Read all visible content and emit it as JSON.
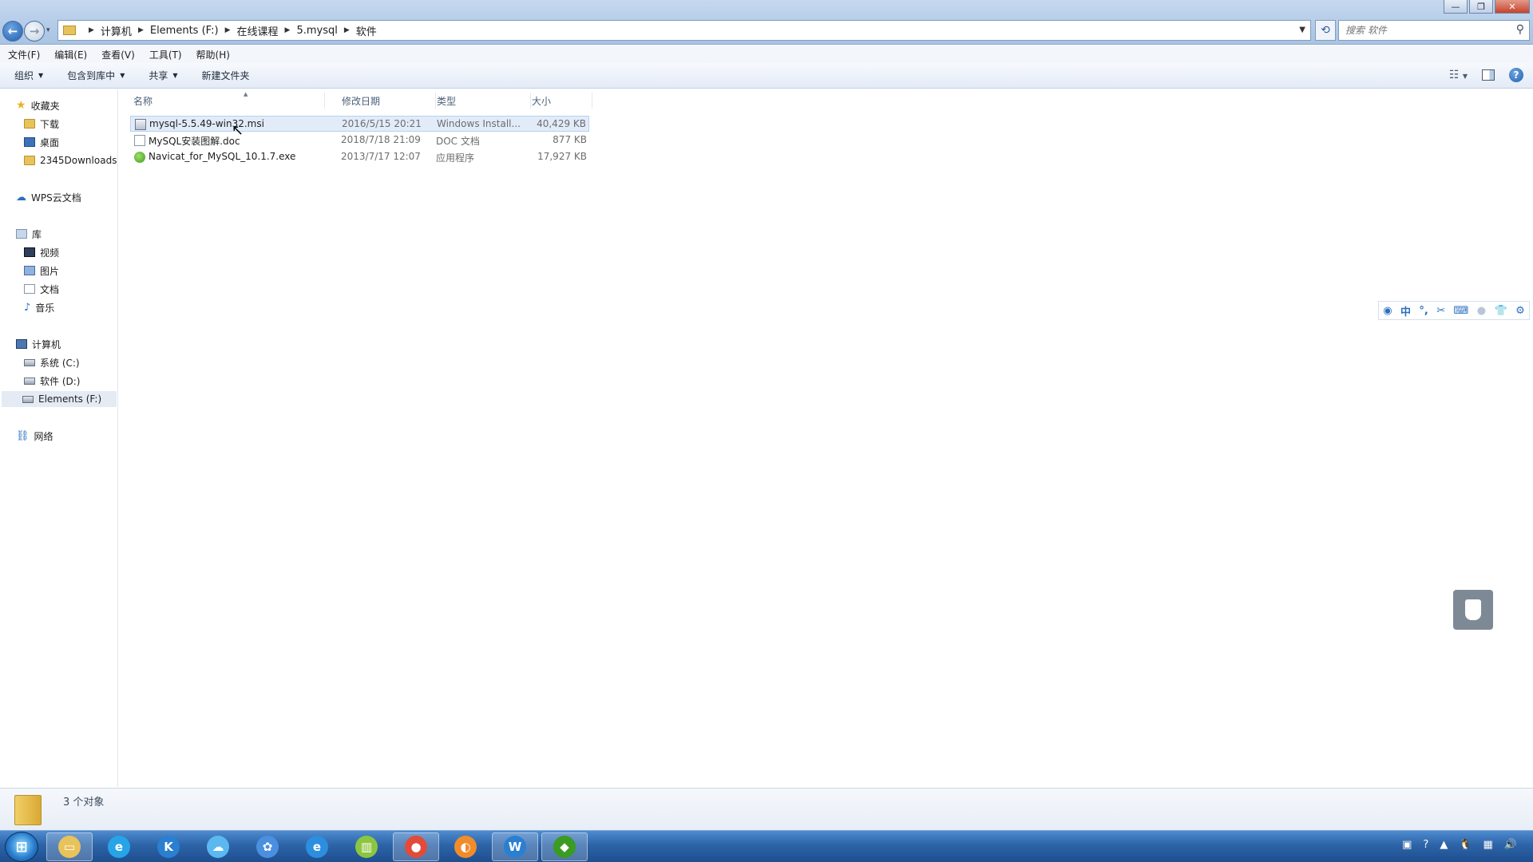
{
  "window": {
    "nav": {
      "back": "←",
      "forward": "→",
      "dropdown": "▾"
    },
    "breadcrumb": [
      "计算机",
      "Elements (F:)",
      "在线课程",
      "5.mysql",
      "软件"
    ],
    "search_placeholder": "搜索 软件",
    "controls": {
      "minimize": "—",
      "maximize": "❐",
      "close": "✕"
    }
  },
  "menubar": [
    "文件(F)",
    "编辑(E)",
    "查看(V)",
    "工具(T)",
    "帮助(H)"
  ],
  "commands": [
    {
      "label": "组织",
      "has_menu": true
    },
    {
      "label": "包含到库中",
      "has_menu": true
    },
    {
      "label": "共享",
      "has_menu": true
    },
    {
      "label": "新建文件夹",
      "has_menu": false
    }
  ],
  "command_right": {
    "help": "?"
  },
  "sidebar": {
    "favorites": {
      "label": "收藏夹",
      "items": [
        "下载",
        "桌面",
        "2345Downloads"
      ]
    },
    "wps": {
      "label": "WPS云文档"
    },
    "libraries": {
      "label": "库",
      "items": [
        "视频",
        "图片",
        "文档",
        "音乐"
      ]
    },
    "computer": {
      "label": "计算机",
      "items": [
        "系统 (C:)",
        "软件 (D:)",
        "Elements (F:)"
      ],
      "selected": "Elements (F:)"
    },
    "network": {
      "label": "网络"
    }
  },
  "columns": {
    "name": "名称",
    "date": "修改日期",
    "type": "类型",
    "size": "大小"
  },
  "files": [
    {
      "name": "mysql-5.5.49-win32.msi",
      "date": "2016/5/15 20:21",
      "type": "Windows Install...",
      "size": "40,429 KB",
      "icon": "msi-installer-icon",
      "selected": true
    },
    {
      "name": "MySQL安装图解.doc",
      "date": "2018/7/18 21:09",
      "type": "DOC 文档",
      "size": "877 KB",
      "icon": "doc-icon",
      "selected": false
    },
    {
      "name": "Navicat_for_MySQL_10.1.7.exe",
      "date": "2013/7/17 12:07",
      "type": "应用程序",
      "size": "17,927 KB",
      "icon": "navicat-app-icon",
      "selected": false
    }
  ],
  "ime_toolbar": {
    "mode": "中",
    "items": [
      "user-icon",
      "chinese-mode-icon",
      "punctuation-icon",
      "scissors-icon",
      "keyboard-icon",
      "person-icon",
      "skin-icon",
      "settings-icon"
    ]
  },
  "status": {
    "count_text": "3 个对象"
  },
  "taskbar": {
    "start_label": "⊞",
    "apps": [
      {
        "name": "explorer",
        "glyph": "▭",
        "color": "#e8c25a",
        "active": true
      },
      {
        "name": "browser-e",
        "glyph": "e",
        "color": "#27a4e8",
        "active": false
      },
      {
        "name": "k-app",
        "glyph": "K",
        "color": "#2a7fd0",
        "active": false
      },
      {
        "name": "cloud-app",
        "glyph": "☁",
        "color": "#5bb8f0",
        "active": false
      },
      {
        "name": "baidu-netdisk",
        "glyph": "✿",
        "color": "#4a8fe0",
        "active": false
      },
      {
        "name": "internet-explorer",
        "glyph": "e",
        "color": "#2d8ee0",
        "active": false
      },
      {
        "name": "chart-app",
        "glyph": "▥",
        "color": "#8cc63f",
        "active": false
      },
      {
        "name": "chrome",
        "glyph": "●",
        "color": "#e24b3a",
        "active": true
      },
      {
        "name": "orange-app",
        "glyph": "◐",
        "color": "#f08c2a",
        "active": false
      },
      {
        "name": "wps-writer",
        "glyph": "W",
        "color": "#2a7fd0",
        "active": true
      },
      {
        "name": "navicat",
        "glyph": "◆",
        "color": "#3b9b22",
        "active": true
      }
    ]
  }
}
